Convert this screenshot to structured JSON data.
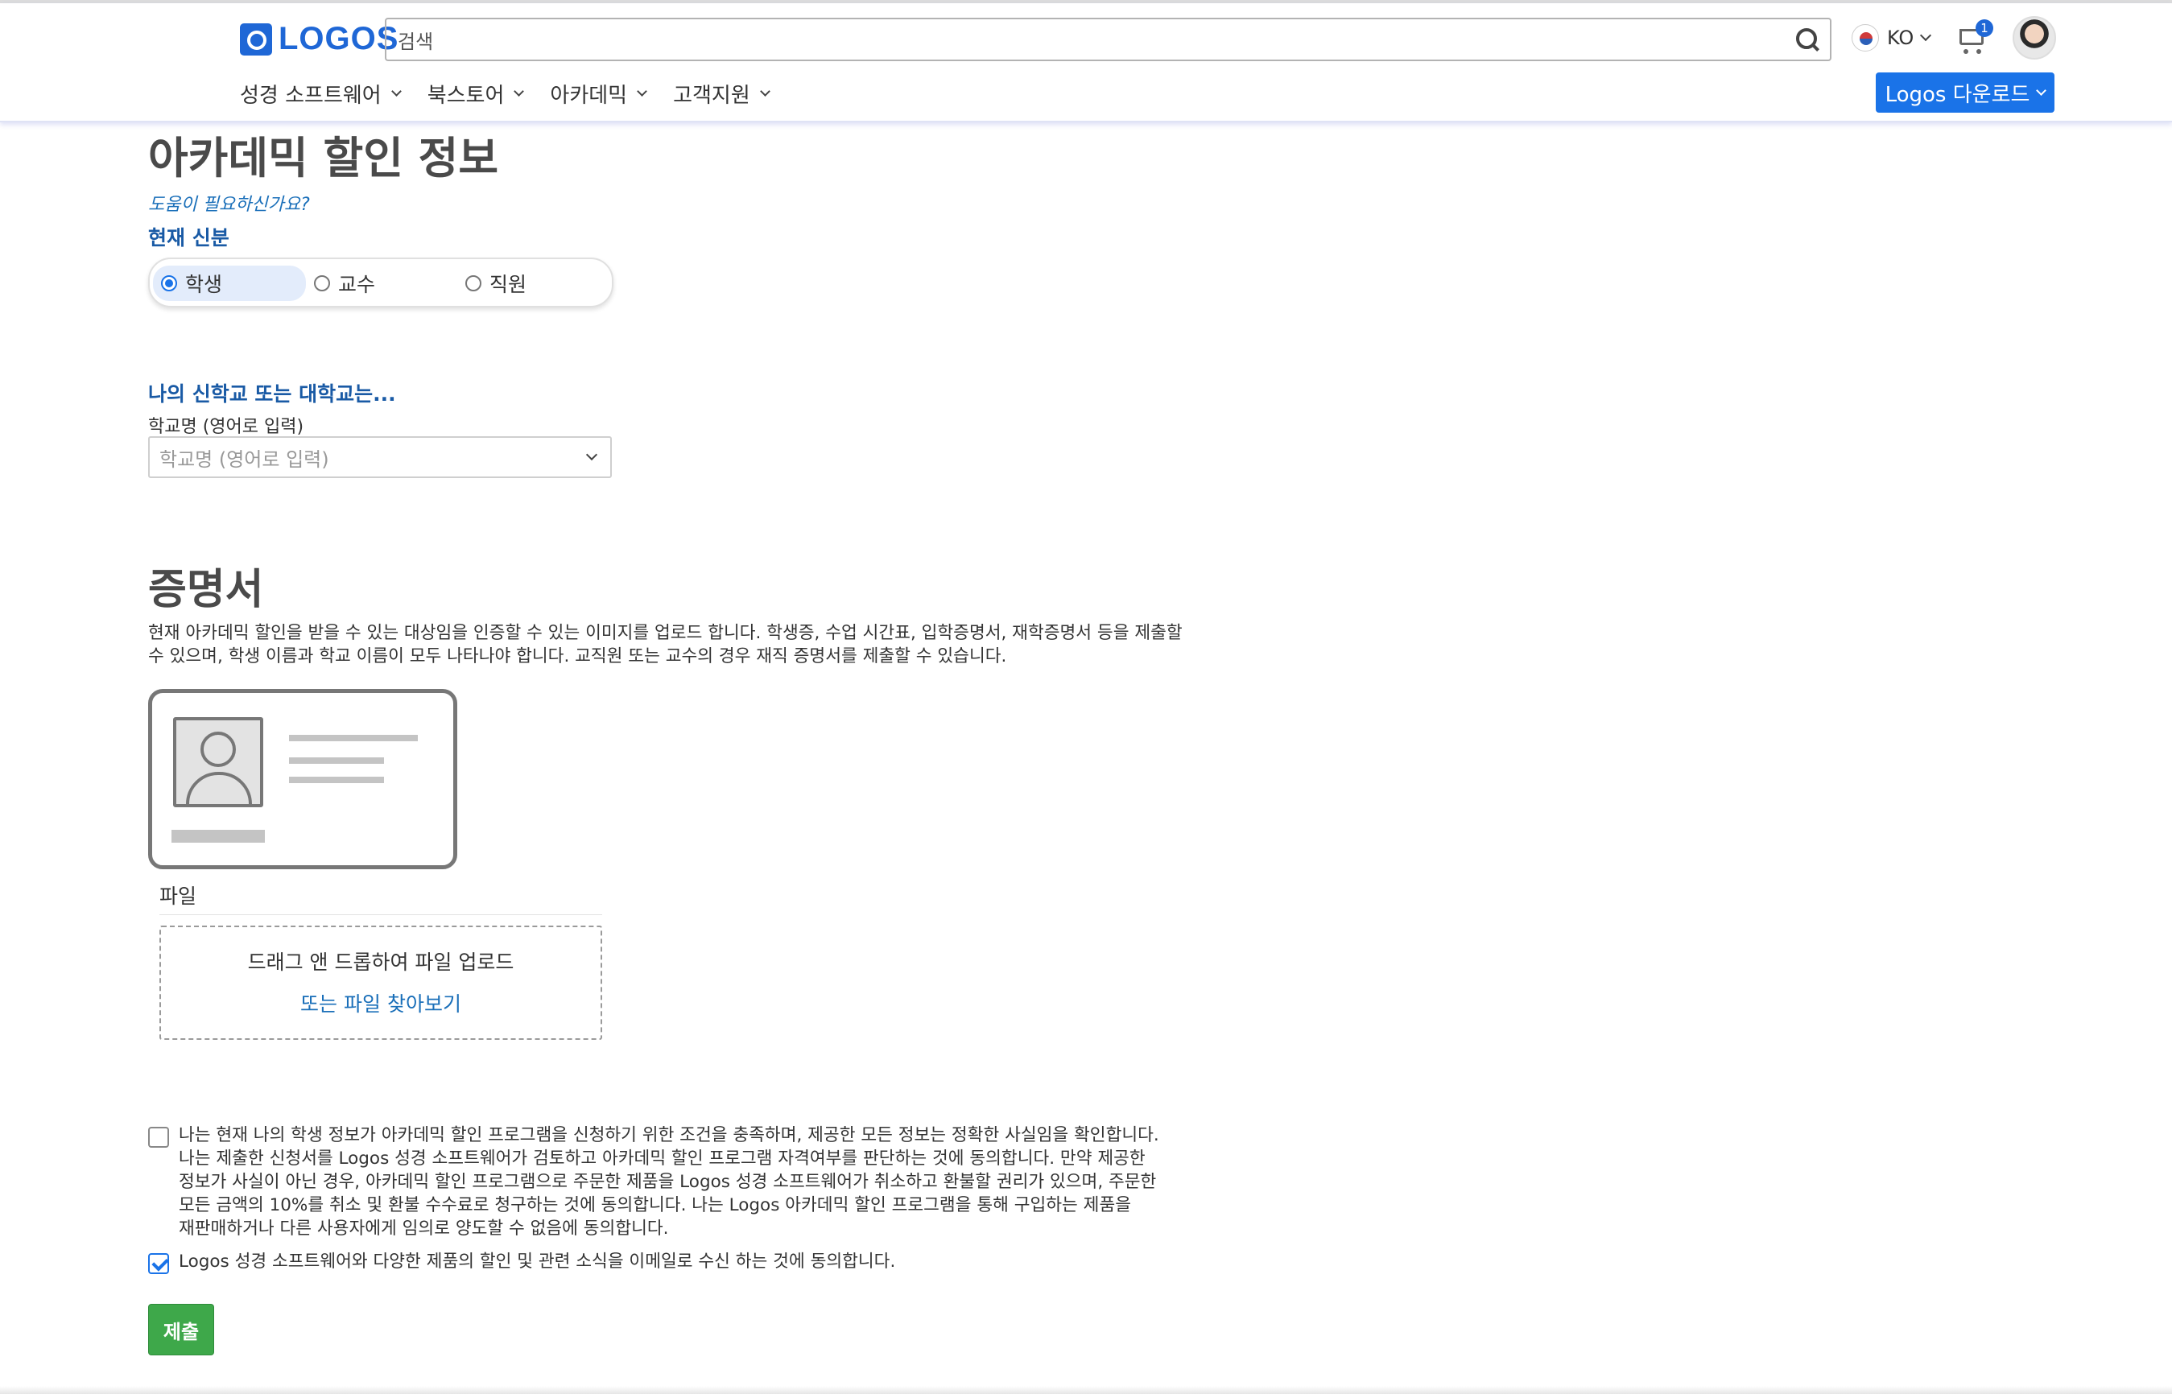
{
  "header": {
    "logo_text": "LOGOS",
    "search": {
      "value": "검색"
    },
    "language": "KO",
    "cart_count": "1",
    "download_label": "Logos 다운로드"
  },
  "nav": {
    "items": [
      {
        "label": "성경 소프트웨어"
      },
      {
        "label": "북스토어"
      },
      {
        "label": "아카데믹"
      },
      {
        "label": "고객지원"
      }
    ]
  },
  "main": {
    "title": "아카데믹 할인 정보",
    "help_link": "도움이 필요하신가요?",
    "status_heading": "현재 신분",
    "roles": [
      {
        "label": "학생",
        "selected": true
      },
      {
        "label": "교수",
        "selected": false
      },
      {
        "label": "직원",
        "selected": false
      }
    ],
    "school_heading": "나의 신학교 또는 대학교는...",
    "school_label": "학교명 (영어로 입력)",
    "school_placeholder": "학교명 (영어로 입력)",
    "cert_title": "증명서",
    "cert_desc_line1": "현재 아카데믹 할인을 받을 수 있는 대상임을 인증할 수 있는 이미지를 업로드 합니다. 학생증, 수업 시간표, 입학증명서, 재학증명서 등을 제출할",
    "cert_desc_line2": "수 있으며, 학생 이름과 학교 이름이 모두 나타나야 합니다. 교직원 또는 교수의 경우 재직 증명서를 제출할 수 있습니다.",
    "file_label": "파일",
    "dropzone_text": "드래그 앤 드롭하여 파일 업로드",
    "dropzone_link": "또는 파일 찾아보기",
    "agreement1_lines": [
      "나는 현재 나의 학생 정보가 아카데믹 할인 프로그램을 신청하기 위한 조건을 충족하며, 제공한 모든 정보는 정확한 사실임을 확인합니다.",
      "나는 제출한 신청서를 Logos 성경 소프트웨어가 검토하고 아카데믹 할인 프로그램 자격여부를 판단하는 것에 동의합니다. 만약 제공한",
      "정보가 사실이 아닌 경우, 아카데믹 할인 프로그램으로 주문한 제품을 Logos 성경 소프트웨어가 취소하고 환불할 권리가 있으며, 주문한",
      "모든 금액의 10%를 취소 및 환불 수수료로 청구하는 것에 동의합니다. 나는 Logos 아카데믹 할인 프로그램을 통해 구입하는 제품을",
      "재판매하거나 다른 사용자에게 임의로 양도할 수 없음에 동의합니다."
    ],
    "agreement1_checked": false,
    "agreement2": "Logos 성경 소프트웨어와 다양한 제품의 할인 및 관련 소식을 이메일로 수신 하는 것에 동의합니다.",
    "agreement2_checked": true,
    "submit_label": "제출"
  },
  "colors": {
    "brand": "#1f67d6",
    "heading_blue": "#195aa5",
    "submit_green": "#3ea84a"
  }
}
